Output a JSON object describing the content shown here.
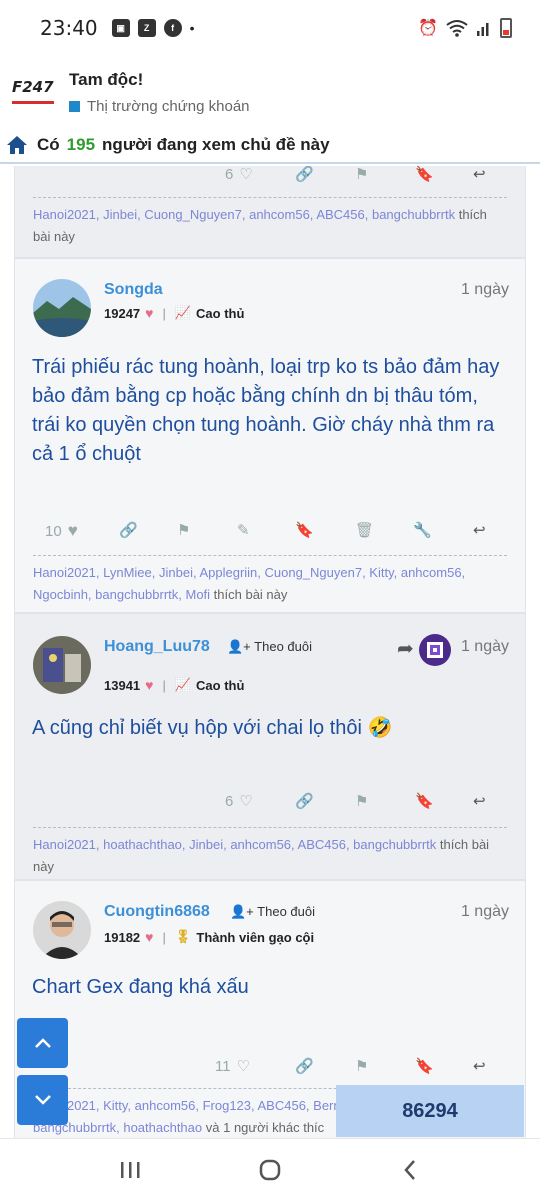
{
  "status": {
    "time": "23:40",
    "icons": [
      "image-icon",
      "zalo-icon",
      "facebook-icon"
    ],
    "dot": "•"
  },
  "header": {
    "logo": "F247",
    "title": "Tam độc!",
    "subtitle": "Thị trường chứng khoán"
  },
  "viewers": {
    "prefix": "Có",
    "count": "195",
    "suffix": "người đang xem chủ đề này"
  },
  "posts": [
    {
      "actions": {
        "likes": "6"
      },
      "liked_by": [
        "Hanoi2021",
        "Jinbei",
        "Cuong_Nguyen7",
        "anhcom56",
        "ABC456",
        "bangchubbrrtk"
      ],
      "liked_suffix": "thích bài này"
    },
    {
      "user": "Songda",
      "points": "19247",
      "rank": "Cao thủ",
      "date": "1 ngày",
      "message": "Trái phiếu rác tung hoành, loại trp ko ts bảo đảm hay bảo đảm bằng cp hoặc bằng chính dn bị thâu tóm, trái ko quyền chọn tung hoành. Giờ cháy nhà thm ra cả 1 ổ chuột",
      "actions": {
        "likes": "10"
      },
      "liked_by": [
        "Hanoi2021",
        "LynMiee",
        "Jinbei",
        "Applegriin",
        "Cuong_Nguyen7",
        "Kitty",
        "anhcom56",
        "Ngocbinh",
        "bangchubbrrtk",
        "Mofi"
      ],
      "liked_suffix": "thích bài này"
    },
    {
      "user": "Hoang_Luu78",
      "follow": "Theo đuôi",
      "points": "13941",
      "rank": "Cao thủ",
      "date": "1 ngày",
      "message": "A cũng chỉ biết vụ hộp với chai lọ thôi 🤣",
      "actions": {
        "likes": "6"
      },
      "liked_by": [
        "Hanoi2021",
        "hoathachthao",
        "Jinbei",
        "anhcom56",
        "ABC456",
        "bangchubbrrtk"
      ],
      "liked_suffix": "thích bài này"
    },
    {
      "user": "Cuongtin6868",
      "follow": "Theo đuôi",
      "points": "19182",
      "rank": "Thành viên gạo cội",
      "date": "1 ngày",
      "message": "Chart Gex đang khá xấu",
      "actions": {
        "likes": "11"
      },
      "liked_line1": "Hanoi2021, Kitty, anhcom56, Frog123, ABC456, Berni",
      "liked_line2_names": "bangchubbrrtk, hoathachthao",
      "liked_line2_suffix": "và 1 người khác thíc"
    }
  ],
  "counter": "86294",
  "colors": {
    "accent": "#3d8fd8",
    "message": "#1e4e9e",
    "viewer_count": "#2e9c2e",
    "fab": "#2b7bd8"
  }
}
